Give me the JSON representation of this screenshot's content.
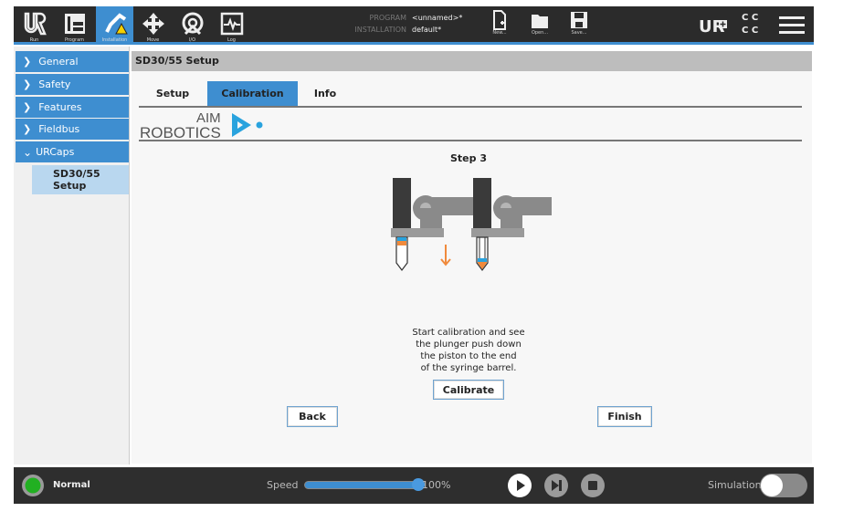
{
  "topbar": {
    "nav": [
      {
        "label": "Run",
        "icon": "ur-logo-icon"
      },
      {
        "label": "Program",
        "icon": "program-icon"
      },
      {
        "label": "Installation",
        "icon": "installation-icon"
      },
      {
        "label": "Move",
        "icon": "move-icon"
      },
      {
        "label": "I/O",
        "icon": "io-icon"
      },
      {
        "label": "Log",
        "icon": "log-icon"
      }
    ],
    "program_label": "PROGRAM",
    "program_value": "<unnamed>*",
    "installation_label": "INSTALLATION",
    "installation_value": "default*",
    "file_buttons": [
      {
        "label": "New...",
        "icon": "new-file-icon"
      },
      {
        "label": "Open...",
        "icon": "folder-icon"
      },
      {
        "label": "Save...",
        "icon": "save-icon"
      }
    ],
    "cc": "C C\nC C"
  },
  "sidebar": {
    "items": [
      {
        "label": "General"
      },
      {
        "label": "Safety"
      },
      {
        "label": "Features"
      },
      {
        "label": "Fieldbus"
      },
      {
        "label": "URCaps",
        "expanded": true
      }
    ],
    "sub_item": "SD30/55 Setup"
  },
  "main": {
    "title": "SD30/55 Setup",
    "tabs": [
      {
        "label": "Setup"
      },
      {
        "label": "Calibration",
        "active": true
      },
      {
        "label": "Info"
      }
    ],
    "logo_text": "AIM ROBOTICS",
    "step": "Step 3",
    "instructions": [
      "Start calibration and see",
      "the plunger push down",
      "the piston to the end",
      "of the syringe barrel."
    ],
    "calibrate_label": "Calibrate",
    "back_label": "Back",
    "finish_label": "Finish"
  },
  "bottombar": {
    "status": "Normal",
    "speed_label": "Speed",
    "speed_value": "100%",
    "speed_fraction": 1.0,
    "simulation_label": "Simulation",
    "simulation_on": false
  },
  "colors": {
    "accent": "#3e8ed0",
    "status_ok": "#22b022",
    "orange": "#f08a3c"
  }
}
